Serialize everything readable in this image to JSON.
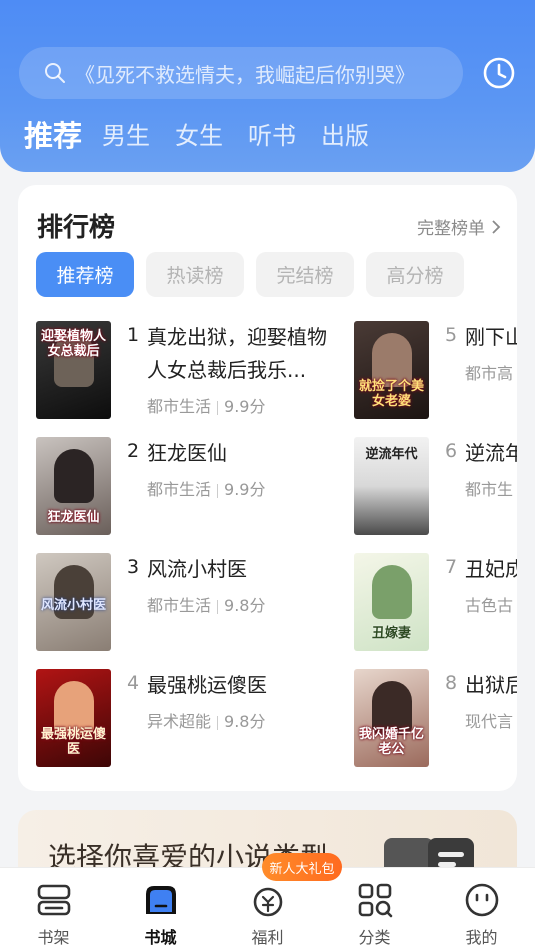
{
  "search": {
    "placeholder": "《见死不救选情夫，我崛起后你别哭》"
  },
  "tabs": [
    {
      "label": "推荐",
      "active": true
    },
    {
      "label": "男生"
    },
    {
      "label": "女生"
    },
    {
      "label": "听书"
    },
    {
      "label": "出版"
    }
  ],
  "ranking": {
    "title": "排行榜",
    "full_list": "完整榜单",
    "chips": [
      "推荐榜",
      "热读榜",
      "完结榜",
      "高分榜"
    ],
    "books": [
      {
        "rank": "1",
        "title": "真龙出狱，迎娶植物人女总裁后我乐...",
        "category": "都市生活",
        "score": "9.9分",
        "cover_text": "迎娶植物人女总裁后"
      },
      {
        "rank": "2",
        "title": "狂龙医仙",
        "category": "都市生活",
        "score": "9.9分",
        "cover_text": "狂龙医仙"
      },
      {
        "rank": "3",
        "title": "风流小村医",
        "category": "都市生活",
        "score": "9.8分",
        "cover_text": "风流小村医"
      },
      {
        "rank": "4",
        "title": "最强桃运傻医",
        "category": "异术超能",
        "score": "9.8分",
        "cover_text": "最强桃运傻医"
      },
      {
        "rank": "5",
        "title": "刚下山美女老",
        "category": "都市高",
        "score": "",
        "cover_text": "就捡了个美女老婆"
      },
      {
        "rank": "6",
        "title": "逆流年开始和",
        "category": "都市生",
        "score": "",
        "cover_text": "逆流年代"
      },
      {
        "rank": "7",
        "title": "丑妃成",
        "category": "古色古",
        "score": "",
        "cover_text": "丑嫁妻"
      },
      {
        "rank": "8",
        "title": "出狱后亿老公",
        "category": "现代言",
        "score": "",
        "cover_text": "我闪婚千亿老公"
      }
    ]
  },
  "promo": {
    "title": "选择你喜爱的小说类型"
  },
  "bottom_nav": [
    {
      "label": "书架",
      "icon": "bookshelf-icon"
    },
    {
      "label": "书城",
      "icon": "bookstore-icon",
      "active": true
    },
    {
      "label": "福利",
      "icon": "welfare-icon"
    },
    {
      "label": "分类",
      "icon": "category-icon"
    },
    {
      "label": "我的",
      "icon": "profile-icon"
    }
  ],
  "gift_badge": "新人大礼包",
  "colors": {
    "accent": "#4a8ef5",
    "header": "#5b96f3",
    "badge": "#ff7a22"
  }
}
